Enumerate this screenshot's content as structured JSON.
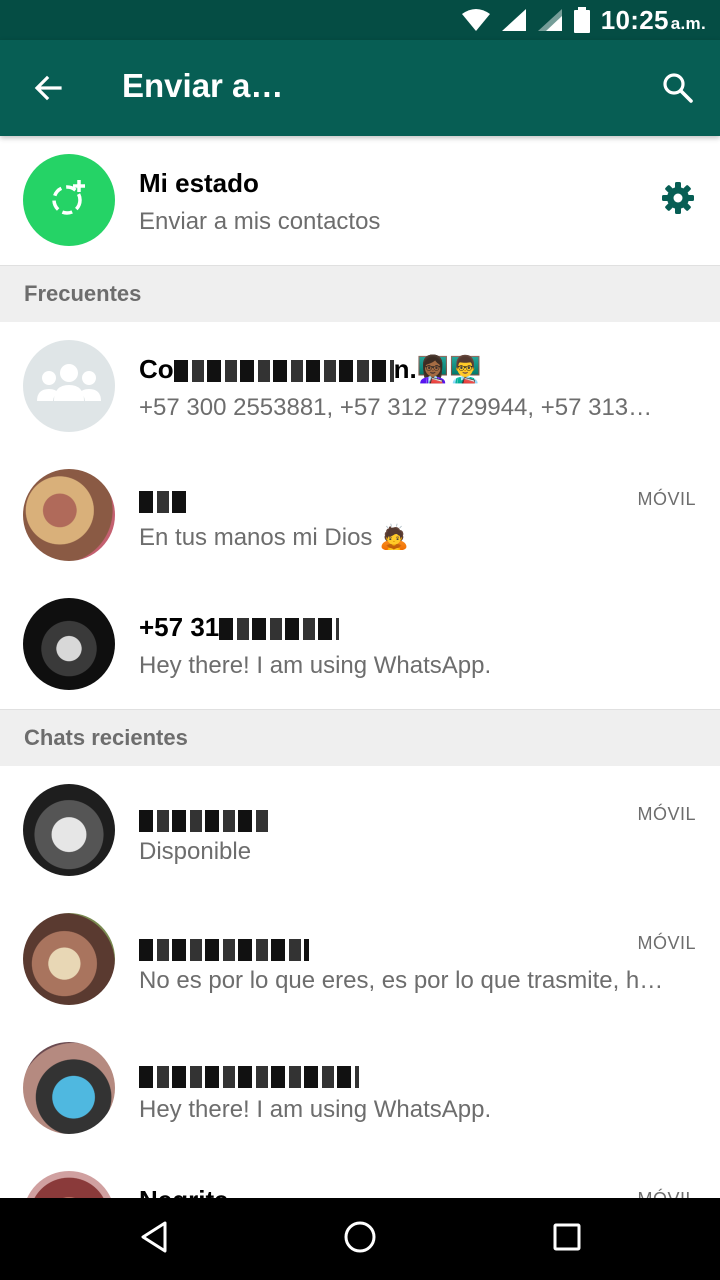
{
  "status_bar": {
    "time": "10:25",
    "ampm": "a.m."
  },
  "app_bar": {
    "title": "Enviar a…"
  },
  "my_status": {
    "title": "Mi estado",
    "subtitle": "Enviar a mis contactos"
  },
  "sections": {
    "frequent": "Frecuentes",
    "recent": "Chats recientes"
  },
  "frequent": [
    {
      "name_visible": "Co",
      "name_end": "n.👩🏾‍🏫👨‍🏫",
      "subtitle": "+57 300 2553881, +57 312 7729944, +57 313…",
      "tag": ""
    },
    {
      "name_visible": "",
      "subtitle": "En tus manos mi Dios 🙇",
      "tag": "MÓVIL"
    },
    {
      "name_visible": "+57 31",
      "subtitle": "Hey there! I am using WhatsApp.",
      "tag": ""
    }
  ],
  "recent": [
    {
      "name_visible": "",
      "subtitle": "Disponible",
      "tag": "MÓVIL"
    },
    {
      "name_visible": "",
      "subtitle": "No es por lo que eres, es por lo que trasmite, h…",
      "tag": "MÓVIL"
    },
    {
      "name_visible": "",
      "subtitle": "Hey there! I am using WhatsApp.",
      "tag": ""
    },
    {
      "name_visible": "Negrita",
      "subtitle": "",
      "tag": "MÓVIL"
    }
  ],
  "colors": {
    "status_bar": "#054d44",
    "app_bar": "#075e54",
    "status_avatar": "#25d366",
    "accent": "#075e54"
  },
  "icons": [
    "wifi-icon",
    "signal-icon",
    "battery-icon",
    "back-arrow-icon",
    "search-icon",
    "add-status-icon",
    "gear-icon",
    "group-icon",
    "nav-back-icon",
    "nav-home-icon",
    "nav-recents-icon"
  ]
}
